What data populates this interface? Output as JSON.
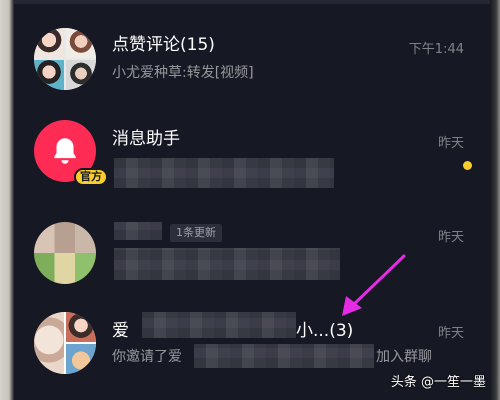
{
  "colors": {
    "background": "#161823",
    "accent_red": "#fe2c55",
    "accent_yellow": "#facd2c",
    "arrow_magenta": "#e62be6"
  },
  "messages": [
    {
      "title": "点赞评论(15)",
      "subtitle": "小尤爱种草:转发[视频]",
      "time": "下午1:44",
      "avatar": "group-avatar"
    },
    {
      "title": "消息助手",
      "badge": "官方",
      "time": "昨天",
      "unread": true,
      "avatar": "bell-icon"
    },
    {
      "tag": "1条更新",
      "time": "昨天",
      "avatar": "blurred-avatar"
    },
    {
      "title_prefix": "爱",
      "title_suffix": "小...(3)",
      "subtitle_prefix": "你邀请了爱",
      "subtitle_suffix": "加入群聊",
      "time": "昨天",
      "avatar": "group-avatar"
    }
  ],
  "watermark": "头条 @一笙一墨"
}
